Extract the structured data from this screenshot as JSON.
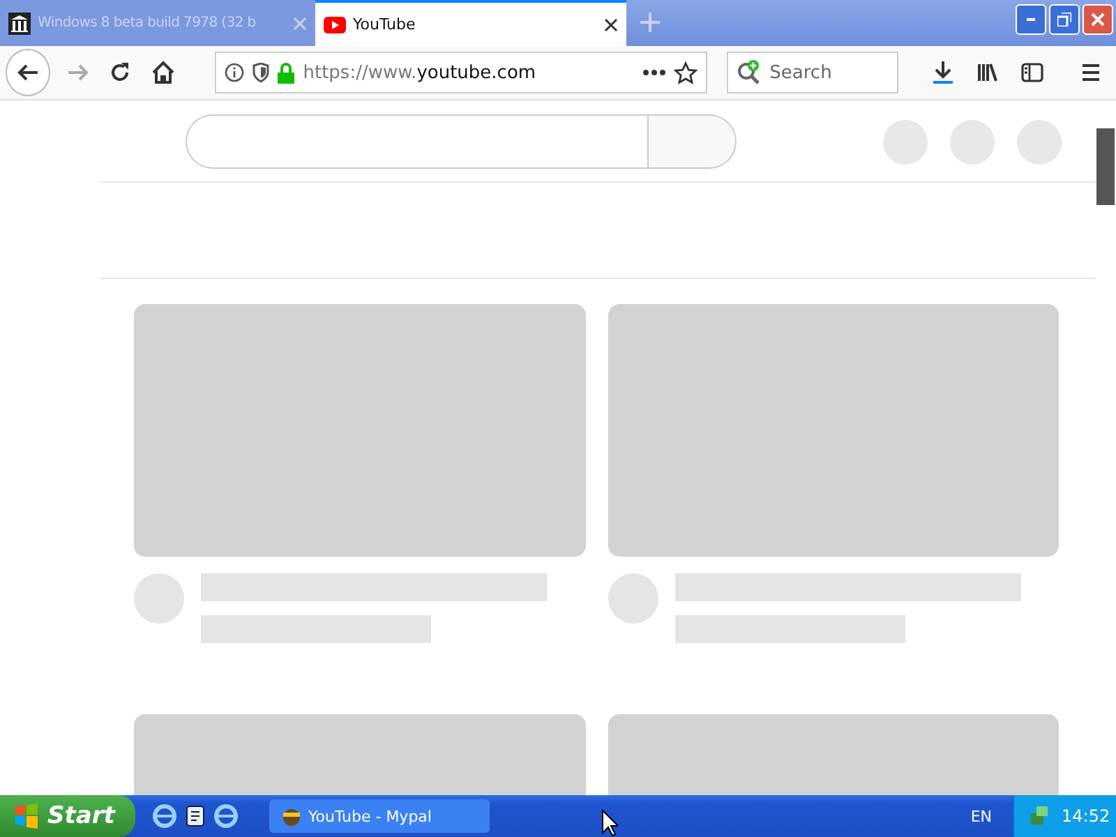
{
  "tabs": [
    {
      "title": "Windows 8 beta build 7978 (32 b",
      "selected": false
    },
    {
      "title": "YouTube",
      "selected": true
    }
  ],
  "address": {
    "scheme": "https://www.",
    "host": "youtube.com"
  },
  "search": {
    "placeholder": "Search"
  },
  "taskbar": {
    "start": "Start",
    "tasks": [
      {
        "title": "YouTube - Mypal",
        "selected": false
      }
    ],
    "language": "EN",
    "clock": "14:52"
  }
}
